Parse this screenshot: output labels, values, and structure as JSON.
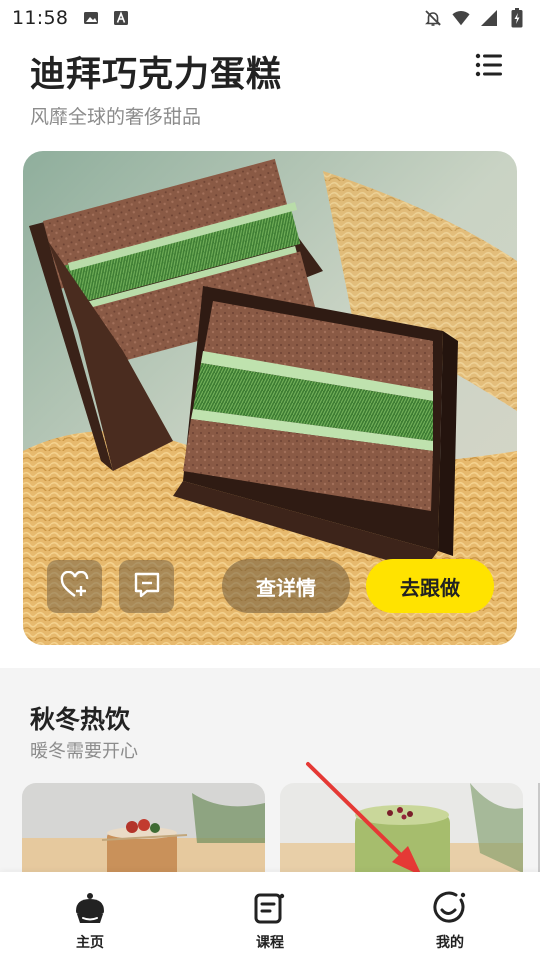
{
  "status_bar": {
    "time": "11:58",
    "left_icons": [
      "image-icon",
      "text-a-icon"
    ],
    "right_icons": [
      "bell-off-icon",
      "wifi-icon",
      "signal-icon",
      "battery-charging-icon"
    ]
  },
  "header": {
    "title": "迪拜巧克力蛋糕",
    "subtitle": "风靡全球的奢侈甜品",
    "menu_icon": "list-menu-icon"
  },
  "hero": {
    "image": "chocolate-cake-photo",
    "favorite_icon": "heart-plus-icon",
    "comment_icon": "comment-icon",
    "detail_label": "查详情",
    "follow_label": "去跟做",
    "accent": "#ffe300"
  },
  "section": {
    "title": "秋冬热饮",
    "subtitle": "暖冬需要开心"
  },
  "cards": [
    {
      "image": "drink-photo-1"
    },
    {
      "image": "drink-photo-2"
    }
  ],
  "bottom_nav": {
    "items": [
      {
        "label": "主页",
        "icon": "cupcake-icon"
      },
      {
        "label": "课程",
        "icon": "course-book-icon"
      },
      {
        "label": "我的",
        "icon": "smile-face-icon"
      }
    ]
  },
  "annotation": {
    "color": "#e53935"
  }
}
